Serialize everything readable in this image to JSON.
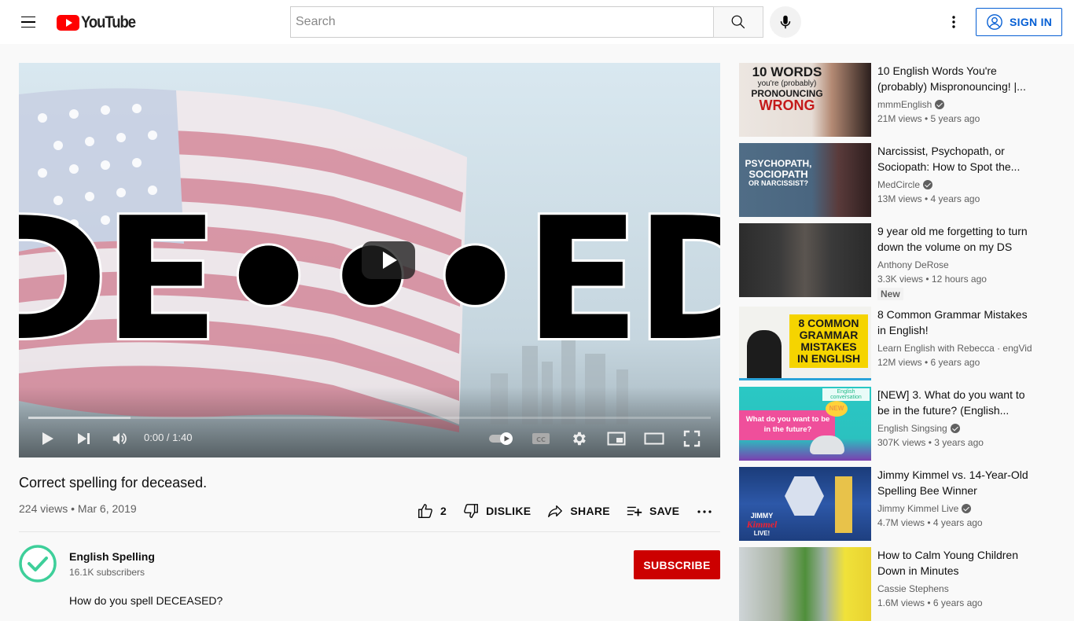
{
  "header": {
    "logo_text": "YouTube",
    "search_placeholder": "Search",
    "signin_label": "SIGN IN"
  },
  "player": {
    "thumbnail_text": "DE•••ED",
    "current_time": "0:00",
    "duration": "1:40",
    "time_display": "0:00 / 1:40",
    "buffered_fraction": 0.15,
    "autoplay": true
  },
  "video": {
    "title": "Correct spelling for deceased.",
    "meta": "224 views • Mar 6, 2019",
    "likes": "2",
    "dislike_label": "DISLIKE",
    "share_label": "SHARE",
    "save_label": "SAVE"
  },
  "channel": {
    "name": "English Spelling",
    "subscribers": "16.1K subscribers",
    "subscribe_label": "SUBSCRIBE",
    "avatar_color": "#3ecf9a"
  },
  "description": {
    "first_line": "How do you spell DECEASED?"
  },
  "related": [
    {
      "title": "10 English Words You're (probably) Mispronouncing! |...",
      "channel": "mmmEnglish",
      "verified": true,
      "stats": "21M views • 5 years ago",
      "thumb_lines": [
        "10 WORDS",
        "you're (probably)",
        "PRONOUNCING",
        "WRONG"
      ]
    },
    {
      "title": "Narcissist, Psychopath, or Sociopath: How to Spot the...",
      "channel": "MedCircle",
      "verified": true,
      "stats": "13M views • 4 years ago",
      "thumb_lines": [
        "PSYCHOPATH,",
        "SOCIOPATH",
        "OR NARCISSIST?"
      ]
    },
    {
      "title": "9 year old me forgetting to turn down the volume on my DS 💀...",
      "channel": "Anthony DeRose",
      "verified": false,
      "stats": "3.3K views • 12 hours ago",
      "badge": "New"
    },
    {
      "title": "8 Common Grammar Mistakes in English!",
      "channel": "Learn English with Rebecca · engVid",
      "verified": false,
      "stats": "12M views • 6 years ago",
      "thumb_lines": [
        "8 COMMON",
        "GRAMMAR",
        "MISTAKES",
        "IN ENGLISH"
      ]
    },
    {
      "title": "[NEW] 3. What do you want to be in the future? (English...",
      "channel": "English Singsing",
      "verified": true,
      "stats": "307K views • 3 years ago",
      "thumb_lines": [
        "What do you want to be",
        "in the future?"
      ],
      "thumb_tag": "English conversation",
      "thumb_badge": "NEW"
    },
    {
      "title": "Jimmy Kimmel vs. 14-Year-Old Spelling Bee Winner",
      "channel": "Jimmy Kimmel Live",
      "verified": true,
      "stats": "4.7M views • 4 years ago",
      "thumb_lines": [
        "JIMMY",
        "Kimmel",
        "LIVE!"
      ]
    },
    {
      "title": "How to Calm Young Children Down in Minutes",
      "channel": "Cassie Stephens",
      "verified": false,
      "stats": "1.6M views • 6 years ago"
    }
  ]
}
